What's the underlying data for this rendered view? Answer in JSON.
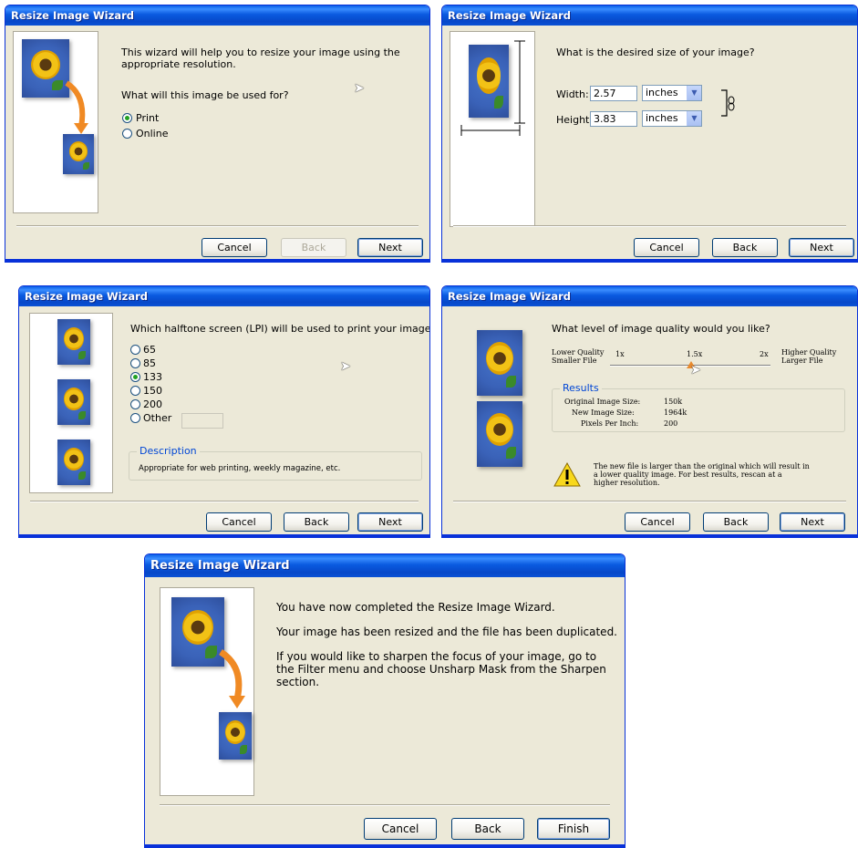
{
  "window_title": "Resize Image Wizard",
  "buttons": {
    "cancel": "Cancel",
    "back": "Back",
    "next": "Next",
    "finish": "Finish"
  },
  "step1": {
    "intro": [
      "This wizard will help you to resize your image using the",
      "appropriate resolution."
    ],
    "question": "What will this image be used for?",
    "options": [
      "Print",
      "Online"
    ],
    "selected": "Print"
  },
  "step2": {
    "question": "What is the desired size of your image?",
    "width_label": "Width:",
    "width_value": "2.57",
    "height_label": "Height:",
    "height_value": "3.83",
    "unit": "inches"
  },
  "step3": {
    "question": "Which halftone screen (LPI) will be used to print your image?",
    "options": [
      "65",
      "85",
      "133",
      "150",
      "200",
      "Other"
    ],
    "selected": "133",
    "other_value": "",
    "description_title": "Description",
    "description": "Appropriate for web printing, weekly magazine, etc."
  },
  "step4": {
    "question": "What level of image quality would you like?",
    "left_label": [
      "Lower Quality",
      "Smaller File"
    ],
    "right_label": [
      "Higher Quality",
      "Larger File"
    ],
    "ticks": [
      "1x",
      "1.5x",
      "2x"
    ],
    "slider_value": "1.5x",
    "results_title": "Results",
    "results": [
      {
        "label": "Original Image Size:",
        "value": "150k"
      },
      {
        "label": "New Image Size:",
        "value": "1964k"
      },
      {
        "label": "Pixels Per Inch:",
        "value": "200"
      }
    ],
    "warning": [
      "The new file is larger than the original which will result in",
      "a lower quality image.  For best results, rescan at a",
      "higher resolution."
    ]
  },
  "step5": {
    "line1": "You have now completed the Resize Image Wizard.",
    "line2": "Your image has been resized and the file has been duplicated.",
    "line3": [
      "If you would like to sharpen the focus of your image, go to",
      "the Filter menu and choose Unsharp Mask from the Sharpen",
      "section."
    ]
  }
}
